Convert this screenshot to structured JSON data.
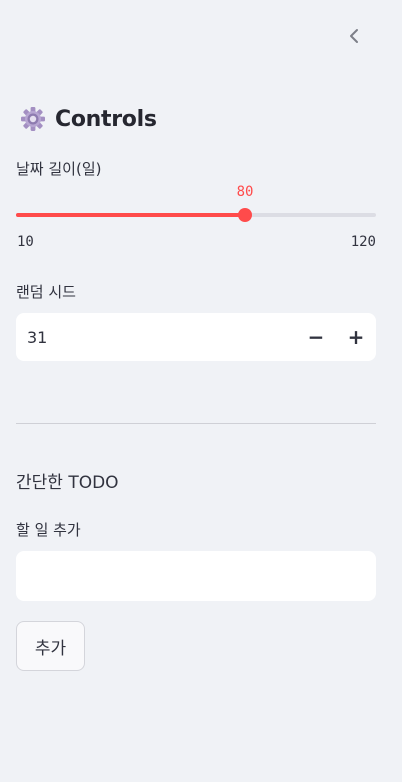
{
  "sidebar": {
    "collapse_icon": "chevron-left-icon",
    "header": {
      "icon": "gear-icon",
      "title": "Controls"
    },
    "slider": {
      "label": "날짜 길이(일)",
      "value": "80",
      "min": "10",
      "max": "120",
      "accent_color": "#ff4b4b"
    },
    "number_input": {
      "label": "랜덤 시드",
      "value": "31",
      "decrement_label": "−",
      "increment_label": "+"
    },
    "todo": {
      "section_title": "간단한 TODO",
      "input_label": "할 일 추가",
      "input_value": "",
      "add_button_label": "추가"
    }
  }
}
